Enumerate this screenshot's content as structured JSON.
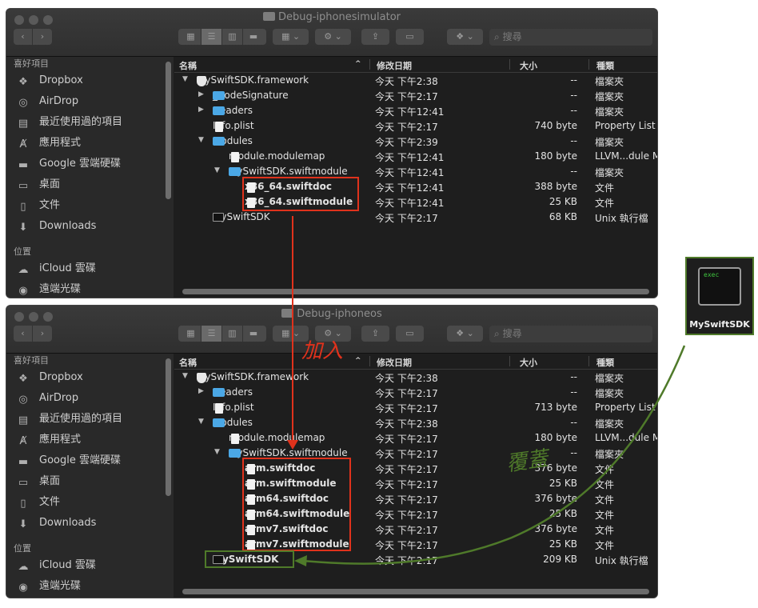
{
  "colors": {
    "red_annotation": "#e0321c",
    "green_annotation": "#4f7a2a",
    "folder": "#4ba8e6"
  },
  "toolbar": {
    "view_icon": "grid-icon",
    "action_icon": "gear-icon",
    "share_icon": "share-icon",
    "tag_icon": "tag-icon",
    "dropbox_icon": "dropbox-icon",
    "search_placeholder": "搜尋"
  },
  "sidebar": {
    "favorites_heading": "喜好項目",
    "items": [
      {
        "label": "Dropbox",
        "icon": "dropbox-icon"
      },
      {
        "label": "AirDrop",
        "icon": "airdrop-icon"
      },
      {
        "label": "最近使用過的項目",
        "icon": "recents-icon"
      },
      {
        "label": "應用程式",
        "icon": "applications-icon"
      },
      {
        "label": "Google 雲端硬碟",
        "icon": "folder-icon"
      },
      {
        "label": "桌面",
        "icon": "desktop-icon"
      },
      {
        "label": "文件",
        "icon": "document-icon"
      },
      {
        "label": "Downloads",
        "icon": "downloads-icon"
      }
    ],
    "locations_heading": "位置",
    "locations": [
      {
        "label": "iCloud 雲碟",
        "icon": "cloud-icon"
      },
      {
        "label": "遠端光碟",
        "icon": "disc-icon"
      }
    ]
  },
  "columns": {
    "name": "名稱",
    "date": "修改日期",
    "size": "大小",
    "kind": "種類"
  },
  "windows": [
    {
      "title": "Debug-iphonesimulator",
      "rows": [
        {
          "name": "MySwiftSDK.framework",
          "date": "今天 下午2:38",
          "size": "--",
          "kind": "檔案夾"
        },
        {
          "name": "_CodeSignature",
          "date": "今天 下午2:17",
          "size": "--",
          "kind": "檔案夾"
        },
        {
          "name": "Headers",
          "date": "今天 下午12:41",
          "size": "--",
          "kind": "檔案夾"
        },
        {
          "name": "Info.plist",
          "date": "今天 下午2:17",
          "size": "740 byte",
          "kind": "Property List"
        },
        {
          "name": "Modules",
          "date": "今天 下午2:39",
          "size": "--",
          "kind": "檔案夾"
        },
        {
          "name": "module.modulemap",
          "date": "今天 下午12:41",
          "size": "180 byte",
          "kind": "LLVM...dule M"
        },
        {
          "name": "MySwiftSDK.swiftmodule",
          "date": "今天 下午12:41",
          "size": "--",
          "kind": "檔案夾"
        },
        {
          "name": "x86_64.swiftdoc",
          "date": "今天 下午12:41",
          "size": "388 byte",
          "kind": "文件"
        },
        {
          "name": "x86_64.swiftmodule",
          "date": "今天 下午12:41",
          "size": "25 KB",
          "kind": "文件"
        },
        {
          "name": "MySwiftSDK",
          "date": "今天 下午2:17",
          "size": "68 KB",
          "kind": "Unix 執行檔"
        }
      ]
    },
    {
      "title": "Debug-iphoneos",
      "rows": [
        {
          "name": "MySwiftSDK.framework",
          "date": "今天 下午2:38",
          "size": "--",
          "kind": "檔案夾"
        },
        {
          "name": "Headers",
          "date": "今天 下午2:17",
          "size": "--",
          "kind": "檔案夾"
        },
        {
          "name": "Info.plist",
          "date": "今天 下午2:17",
          "size": "713 byte",
          "kind": "Property List"
        },
        {
          "name": "Modules",
          "date": "今天 下午2:38",
          "size": "--",
          "kind": "檔案夾"
        },
        {
          "name": "module.modulemap",
          "date": "今天 下午2:17",
          "size": "180 byte",
          "kind": "LLVM...dule M"
        },
        {
          "name": "MySwiftSDK.swiftmodule",
          "date": "今天 下午2:17",
          "size": "--",
          "kind": "檔案夾"
        },
        {
          "name": "arm.swiftdoc",
          "date": "今天 下午2:17",
          "size": "376 byte",
          "kind": "文件"
        },
        {
          "name": "arm.swiftmodule",
          "date": "今天 下午2:17",
          "size": "25 KB",
          "kind": "文件"
        },
        {
          "name": "arm64.swiftdoc",
          "date": "今天 下午2:17",
          "size": "376 byte",
          "kind": "文件"
        },
        {
          "name": "arm64.swiftmodule",
          "date": "今天 下午2:17",
          "size": "25 KB",
          "kind": "文件"
        },
        {
          "name": "armv7.swiftdoc",
          "date": "今天 下午2:17",
          "size": "376 byte",
          "kind": "文件"
        },
        {
          "name": "armv7.swiftmodule",
          "date": "今天 下午2:17",
          "size": "25 KB",
          "kind": "文件"
        },
        {
          "name": "MySwiftSDK",
          "date": "今天 下午2:17",
          "size": "209 KB",
          "kind": "Unix 執行檔"
        }
      ]
    }
  ],
  "annotations": {
    "add_label": "加入",
    "overwrite_label": "覆蓋"
  },
  "exec_file": {
    "badge": "exec",
    "name": "MySwiftSDK"
  }
}
